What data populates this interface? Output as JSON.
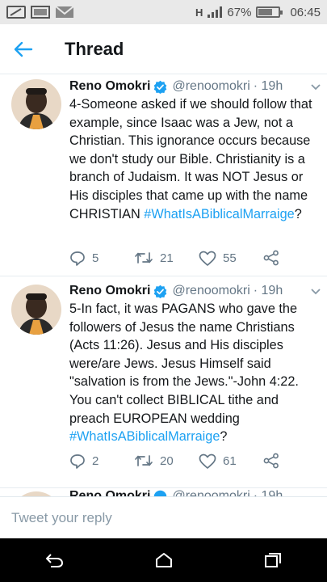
{
  "status_bar": {
    "network": "H",
    "battery_percent": "67%",
    "battery_level": 0.67,
    "time": "06:45",
    "left_icons": [
      "screen-icon",
      "image-icon",
      "mail-icon"
    ]
  },
  "header": {
    "back_icon": "back-arrow-icon",
    "title": "Thread",
    "accent_color": "#1da1f2"
  },
  "tweets": [
    {
      "name": "Reno Omokri",
      "handle": "@renoomokri",
      "time": "· 19h",
      "verified": true,
      "text": "4-Someone asked if we should follow that example, since Isaac was a Jew, not a Christian. This ignorance occurs because we don't study our Bible. Christianity is a branch of Judaism. It was NOT Jesus or His disciples that came up with the name CHRISTIAN",
      "hashtag": "#WhatIsABiblicalMarraige",
      "suffix": "?",
      "replies": "5",
      "retweets": "21",
      "likes": "55"
    },
    {
      "name": "Reno Omokri",
      "handle": "@renoomokri",
      "time": "· 19h",
      "verified": true,
      "text": "5-In fact, it was PAGANS who gave the followers of Jesus the name Christians (Acts 11:26). Jesus and His disciples were/are Jews. Jesus Himself said \"salvation is from the Jews.\"-John 4:22. You can't collect BIBLICAL tithe and preach EUROPEAN wedding",
      "hashtag": "#WhatIsABiblicalMarraige",
      "suffix": "?",
      "replies": "2",
      "retweets": "20",
      "likes": "61"
    },
    {
      "name": "Reno Omokri",
      "handle": "@renoomokri",
      "time": "· 19h",
      "verified": true
    }
  ],
  "reply": {
    "placeholder": "Tweet your reply"
  },
  "nav": {
    "icons": [
      "back-nav-icon",
      "home-nav-icon",
      "recents-nav-icon"
    ]
  }
}
